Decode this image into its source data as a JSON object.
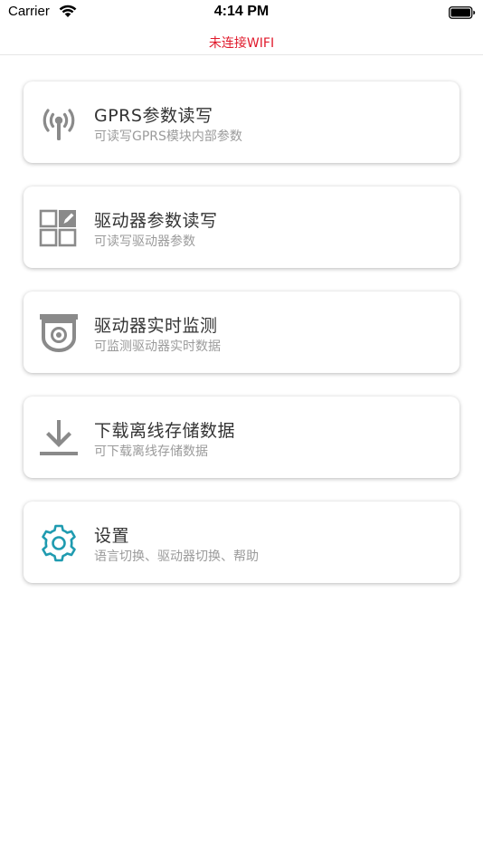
{
  "status_bar": {
    "carrier": "Carrier",
    "time": "4:14 PM"
  },
  "header": {
    "title": "未连接WIFI",
    "title_color": "#e0192b"
  },
  "menu": {
    "items": [
      {
        "title": "GPRS参数读写",
        "subtitle": "可读写GPRS模块内部参数",
        "icon": "antenna-icon",
        "icon_color": "#8a8a8a"
      },
      {
        "title": "驱动器参数读写",
        "subtitle": "可读写驱动器参数",
        "icon": "grid-edit-icon",
        "icon_color": "#8a8a8a"
      },
      {
        "title": "驱动器实时监测",
        "subtitle": "可监测驱动器实时数据",
        "icon": "camera-monitor-icon",
        "icon_color": "#8a8a8a"
      },
      {
        "title": "下载离线存储数据",
        "subtitle": "可下载离线存储数据",
        "icon": "download-icon",
        "icon_color": "#8a8a8a"
      },
      {
        "title": "设置",
        "subtitle": "语言切换、驱动器切换、帮助",
        "icon": "gear-icon",
        "icon_color": "#1f9bb0"
      }
    ]
  }
}
